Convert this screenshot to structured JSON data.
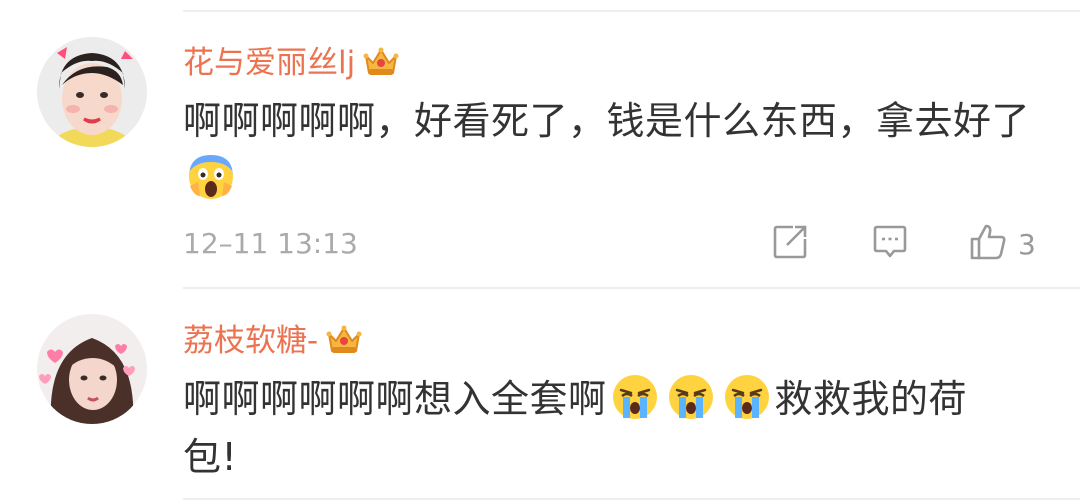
{
  "comments": [
    {
      "username": "花与爱丽丝lj",
      "text_line1": "啊啊啊啊啊，好看死了，钱是什么东西，拿去好了",
      "emoji": "scream-emoji",
      "timestamp": "12–11 13:13",
      "like_count": "3"
    },
    {
      "username": "荔枝软糖-",
      "text_part1": "啊啊啊啊啊啊想入全套啊",
      "emoji": "crying-emoji",
      "text_part2": "救救我的荷",
      "text_line2": "包!"
    }
  ],
  "colors": {
    "username": "#eb7350",
    "text": "#333333",
    "meta": "#aaaaaa",
    "divider": "#eeeeee"
  },
  "icons": [
    "crown-icon",
    "share-icon",
    "comment-icon",
    "like-icon"
  ]
}
